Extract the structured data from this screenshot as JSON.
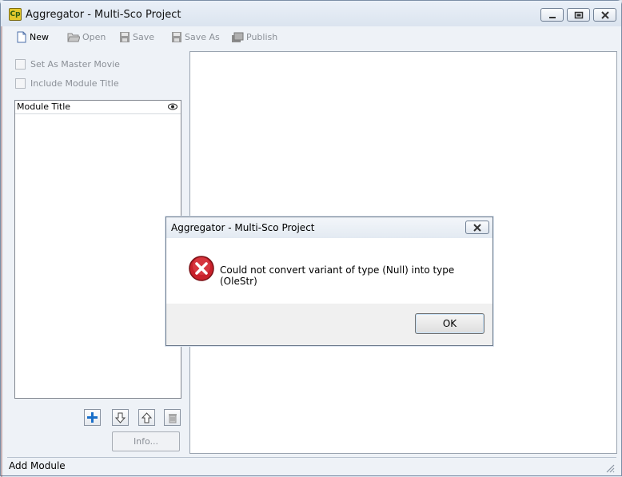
{
  "window": {
    "title": "Aggregator - Multi-Sco Project",
    "icon": "cp-app-icon",
    "icon_text": "Cp"
  },
  "toolbar": {
    "new_label": "New",
    "open_label": "Open",
    "save_label": "Save",
    "save_as_label": "Save As",
    "publish_label": "Publish"
  },
  "options": {
    "master_movie_label": "Set As Master Movie",
    "include_title_label": "Include Module Title"
  },
  "module_list": {
    "header": "Module Title",
    "items": []
  },
  "buttons": {
    "info_label": "Info..."
  },
  "status": {
    "text": "Add Module"
  },
  "dialog": {
    "title": "Aggregator - Multi-Sco Project",
    "message": "Could not convert variant of type (Null) into type (OleStr)",
    "ok_label": "OK"
  },
  "colors": {
    "error_red": "#c8202a",
    "add_blue": "#1a6fc9"
  }
}
